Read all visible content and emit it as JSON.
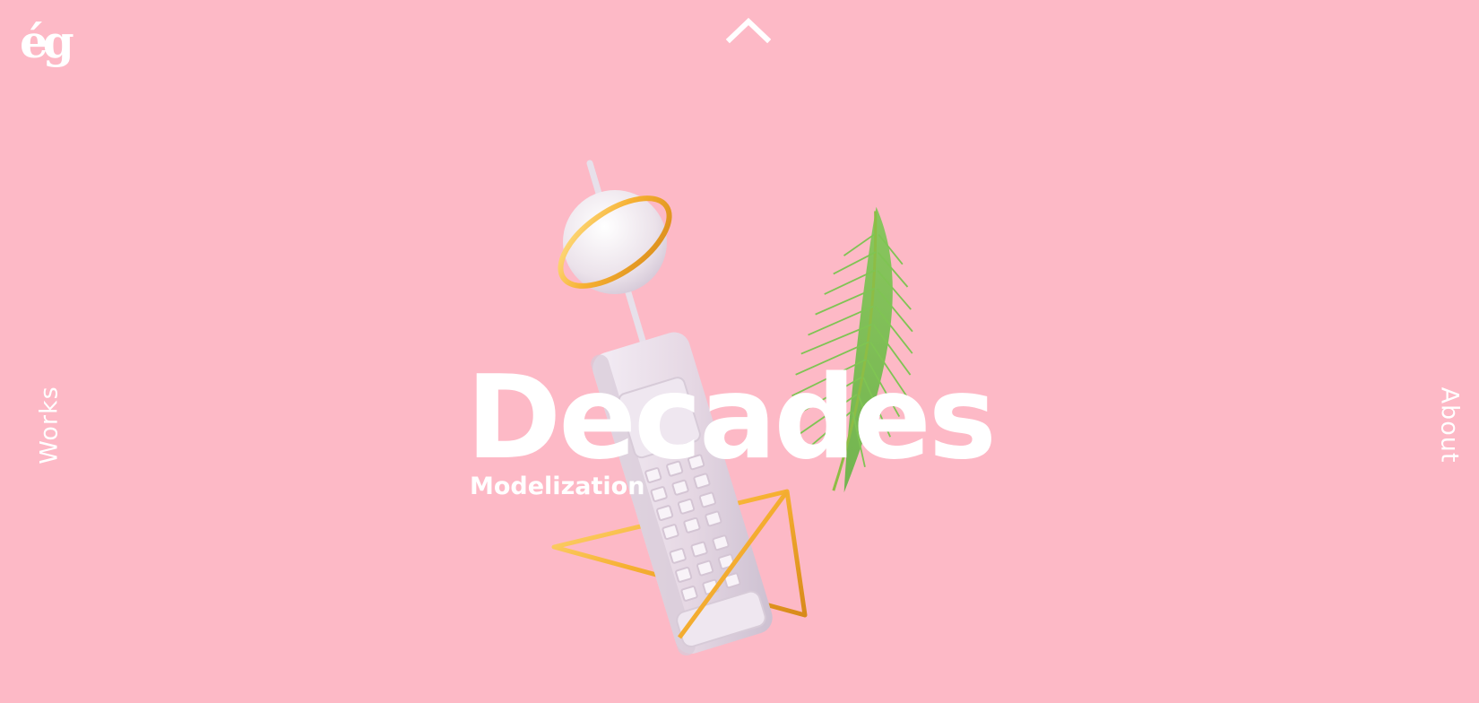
{
  "brand": {
    "logo_text": "ég",
    "background_color": "#fdb9c6",
    "text_color": "#ffffff"
  },
  "navigation": {
    "up_icon": "chevron-up-icon",
    "left_link": "Works",
    "right_link": "About"
  },
  "hero": {
    "title": "Decades",
    "subtitle": "Modelization",
    "image": "3d-retro-phone-with-palm-leaf-and-gold-triangle"
  }
}
